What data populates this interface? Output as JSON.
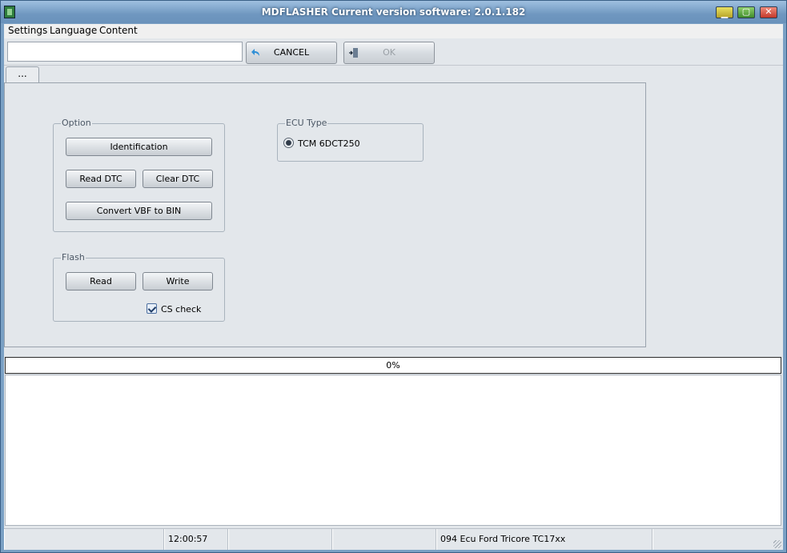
{
  "window": {
    "title": "MDFLASHER  Current version software: 2.0.1.182"
  },
  "menu": {
    "items": [
      "Settings",
      "Language",
      "Content"
    ]
  },
  "toolbar": {
    "input_value": "",
    "cancel_label": "CANCEL",
    "ok_label": "OK"
  },
  "tabs": [
    "..."
  ],
  "option_group": {
    "title": "Option",
    "identification": "Identification",
    "read_dtc": "Read DTC",
    "clear_dtc": "Clear DTC",
    "convert": "Convert VBF to BIN"
  },
  "flash_group": {
    "title": "Flash",
    "read": "Read",
    "write": "Write",
    "cs_check_label": "CS check",
    "cs_check_checked": true
  },
  "ecu_group": {
    "title": "ECU Type",
    "option": "TCM 6DCT250",
    "selected": true
  },
  "progress": {
    "value": 0,
    "label": "0%"
  },
  "log_text": "",
  "status": {
    "cell1": "",
    "time": "12:00:57",
    "cell3": "",
    "cell4": "",
    "protocol": "094 Ecu Ford Tricore TC17xx",
    "cell6": ""
  },
  "colors": {
    "title_bar": "#6f97c0",
    "progress_fill": "#4a90d9"
  }
}
